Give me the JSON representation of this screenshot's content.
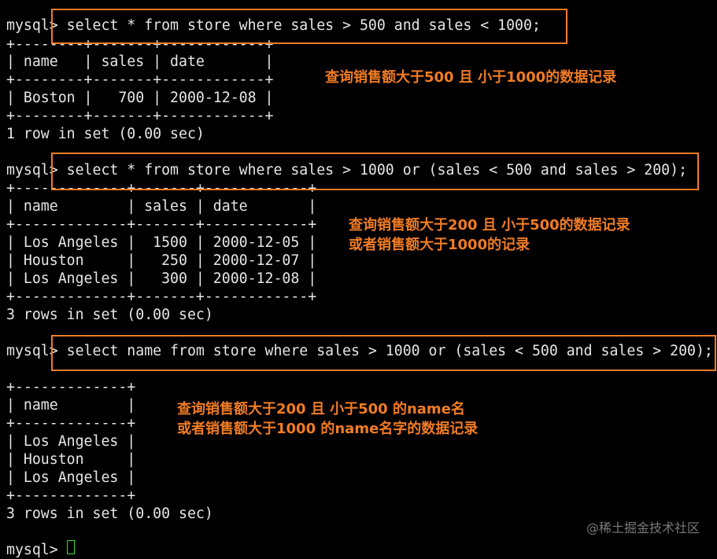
{
  "accent_color": "#f07c25",
  "cursor_color": "#3cdc3c",
  "terminal_lines": [
    {
      "name": "prompt-line-1",
      "text": "mysql> select * from store where sales > 500 and sales < 1000;"
    },
    {
      "name": "table-border",
      "text": "+--------+-------+------------+"
    },
    {
      "name": "table-header-row",
      "text": "| name   | sales | date       |"
    },
    {
      "name": "table-border",
      "text": "+--------+-------+------------+"
    },
    {
      "name": "table-row",
      "text": "| Boston |   700 | 2000-12-08 |"
    },
    {
      "name": "table-border",
      "text": "+--------+-------+------------+"
    },
    {
      "name": "result-summary",
      "text": "1 row in set (0.00 sec)"
    },
    {
      "name": "blank-line",
      "text": ""
    },
    {
      "name": "prompt-line-2",
      "text": "mysql> select * from store where sales > 1000 or (sales < 500 and sales > 200);"
    },
    {
      "name": "table-border",
      "text": "+-------------+-------+------------+"
    },
    {
      "name": "table-header-row",
      "text": "| name        | sales | date       |"
    },
    {
      "name": "table-border",
      "text": "+-------------+-------+------------+"
    },
    {
      "name": "table-row",
      "text": "| Los Angeles |  1500 | 2000-12-05 |"
    },
    {
      "name": "table-row",
      "text": "| Houston     |   250 | 2000-12-07 |"
    },
    {
      "name": "table-row",
      "text": "| Los Angeles |   300 | 2000-12-08 |"
    },
    {
      "name": "table-border",
      "text": "+-------------+-------+------------+"
    },
    {
      "name": "result-summary",
      "text": "3 rows in set (0.00 sec)"
    },
    {
      "name": "blank-line",
      "text": ""
    },
    {
      "name": "prompt-line-3",
      "text": "mysql> select name from store where sales > 1000 or (sales < 500 and sales > 200);"
    },
    {
      "name": "blank-line",
      "text": ""
    },
    {
      "name": "table-border",
      "text": "+-------------+"
    },
    {
      "name": "table-header-row",
      "text": "| name        |"
    },
    {
      "name": "table-border",
      "text": "+-------------+"
    },
    {
      "name": "table-row",
      "text": "| Los Angeles |"
    },
    {
      "name": "table-row",
      "text": "| Houston     |"
    },
    {
      "name": "table-row",
      "text": "| Los Angeles |"
    },
    {
      "name": "table-border",
      "text": "+-------------+"
    },
    {
      "name": "result-summary",
      "text": "3 rows in set (0.00 sec)"
    },
    {
      "name": "blank-line",
      "text": ""
    },
    {
      "name": "prompt-line-current",
      "text": "mysql> "
    }
  ],
  "annotations": {
    "note1": "查询销售额大于500  且  小于1000的数据记录",
    "note2_line1": "查询销售额大于200  且  小于500的数据记录",
    "note2_line2": "或者销售额大于1000的记录",
    "note3_line1": "查询销售额大于200 且 小于500 的name名",
    "note3_line2": "或者销售额大于1000 的name名字的数据记录"
  },
  "watermark": "@稀土掘金技术社区"
}
